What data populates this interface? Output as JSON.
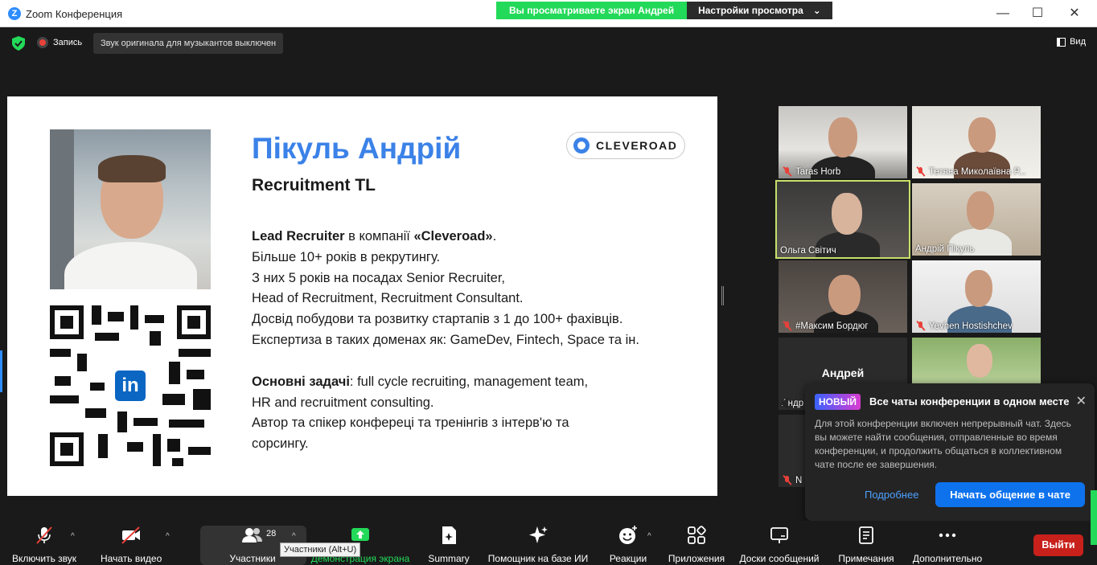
{
  "window": {
    "title": "Zoom Конференция",
    "app_icon": "Z",
    "share_banner": "Вы просматриваете экран Андрей",
    "view_settings": "Настройки просмотра",
    "minimize": "—",
    "maximize": "☐",
    "close": "✕"
  },
  "topbar": {
    "record_label": "Запись",
    "original_sound": "Звук оригинала для музыкантов выключен",
    "view_label": "Вид"
  },
  "slide": {
    "name": "Пікуль Андрій",
    "role": "Recruitment TL",
    "logo_text": "CLEVEROAD",
    "qr_logo": "in",
    "line1_bold_a": "Lead Recruiter",
    "line1_mid": " в компанії ",
    "line1_bold_b": "«Cleveroad»",
    "line1_end": ".",
    "line2": "Більше 10+ років в рекрутингу.",
    "line3": "З них 5 років на посадах Senior Recruiter,",
    "line4": "Head of Recruitment, Recruitment Consultant.",
    "line5": "Досвід побудови та розвитку стартапів з 1 до 100+ фахівців.",
    "line6": "Експертиза в таких доменах як: GameDev, Fintech, Space та ін.",
    "tasks_bold": "Основні задачі",
    "tasks_rest": ": full cycle recruiting, management team,",
    "line8": "HR and recruitment consulting.",
    "line9": "Автор та спікер конфереці та тренінгів з інтерв'ю та",
    "line10": "сорсингу."
  },
  "participants": [
    {
      "name": "Taras Horb",
      "muted": true
    },
    {
      "name": "Тетяна Миколаївна Р...",
      "muted": true
    },
    {
      "name": "Ольга Світич",
      "muted": false,
      "active": true
    },
    {
      "name": "Андрій Пікуль",
      "muted": false
    },
    {
      "name": "#Максим Бордюг",
      "muted": true
    },
    {
      "name": "Yevhen Hostishchev",
      "muted": true
    },
    {
      "name": "Андрей",
      "partial_label": "Андр"
    },
    {
      "name": ""
    },
    {
      "name": "N",
      "muted": true
    }
  ],
  "toast": {
    "badge": "НОВЫЙ",
    "title": "Все чаты конференции в одном месте",
    "body": "Для этой конференции включен непрерывный чат. Здесь вы можете найти сообщения, отправленные во время конференции, и продолжить общаться в коллективном чате после ее завершения.",
    "link": "Подробнее",
    "button": "Начать общение в чате",
    "close": "✕"
  },
  "toolbar": {
    "mute": "Включить звук",
    "video": "Начать видео",
    "participants": "Участники",
    "participants_count": "28",
    "share": "Демонстрация экрана",
    "summary": "Summary",
    "ai": "Помощник на базе ИИ",
    "reactions": "Реакции",
    "apps": "Приложения",
    "whiteboards": "Доски сообщений",
    "notes": "Примечания",
    "more": "Дополнительно",
    "leave": "Выйти",
    "tooltip": "Участники (Alt+U)"
  },
  "colors": {
    "accent_blue": "#2d8cff",
    "share_green": "#23d959",
    "leave_red": "#c8211c",
    "slide_name_blue": "#3b82e8",
    "active_outline": "#c6e06a"
  }
}
